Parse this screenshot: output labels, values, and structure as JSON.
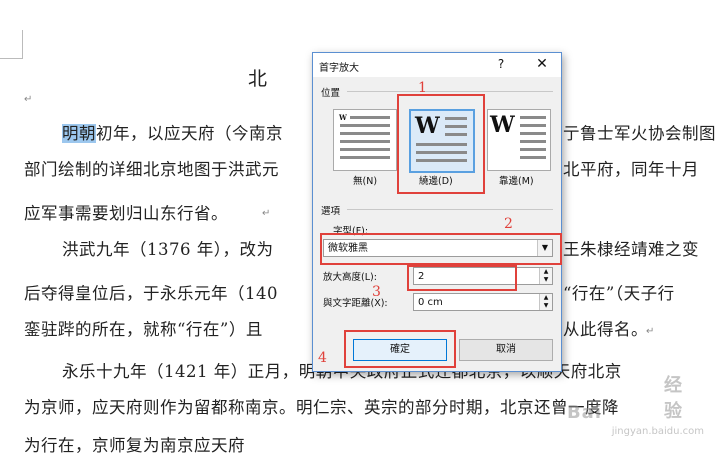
{
  "document": {
    "title": "北",
    "lines": [
      "明朝初年，以应天府（今南京",
      "部门绘制的详细北京地图于洪武元",
      "应军事需要划归山东行省。",
      "洪武九年（1376 年），改为",
      "后夺得皇位后，于永乐元年（140",
      "銮驻跸的所在，就称“行在”）且",
      "永乐十九年（1421 年）正月，明朝中央政府正式迁都北京，以顺天府北京",
      "为京师，应天府则作为留都称南京。明仁宗、英宗的部分时期，北京还曾一度降",
      "为行在，京师复为南京应天府"
    ],
    "selected_text": "明朝",
    "right_fragments": [
      "亍鲁士军火协会制图",
      "北平府，同年十月",
      "王朱棣经靖难之变",
      "“行在”（天子行",
      "从此得名。"
    ]
  },
  "dialog": {
    "title": "首字放大",
    "help": "?",
    "close": "✕",
    "position_group": "位置",
    "positions": [
      {
        "label": "無(N)"
      },
      {
        "label": "繞邊(D)"
      },
      {
        "label": "靠邊(M)"
      }
    ],
    "selected_position": "繞邊(D)",
    "options_group": "選項",
    "font_label": "字型(F):",
    "font_value": "微软雅黑",
    "lines_label": "放大高度(L):",
    "lines_value": "2",
    "distance_label": "與文字距離(X):",
    "distance_value": "0 cm",
    "ok": "確定",
    "cancel": "取消"
  },
  "callouts": [
    "1",
    "2",
    "3",
    "4"
  ],
  "watermark": {
    "logo": "Bai",
    "text": "经验",
    "sub": "jingyan.baidu.com"
  },
  "colors": {
    "selection": "#9cc7ee",
    "callout": "#e0413b",
    "dialog_border": "#5b8fd1"
  }
}
